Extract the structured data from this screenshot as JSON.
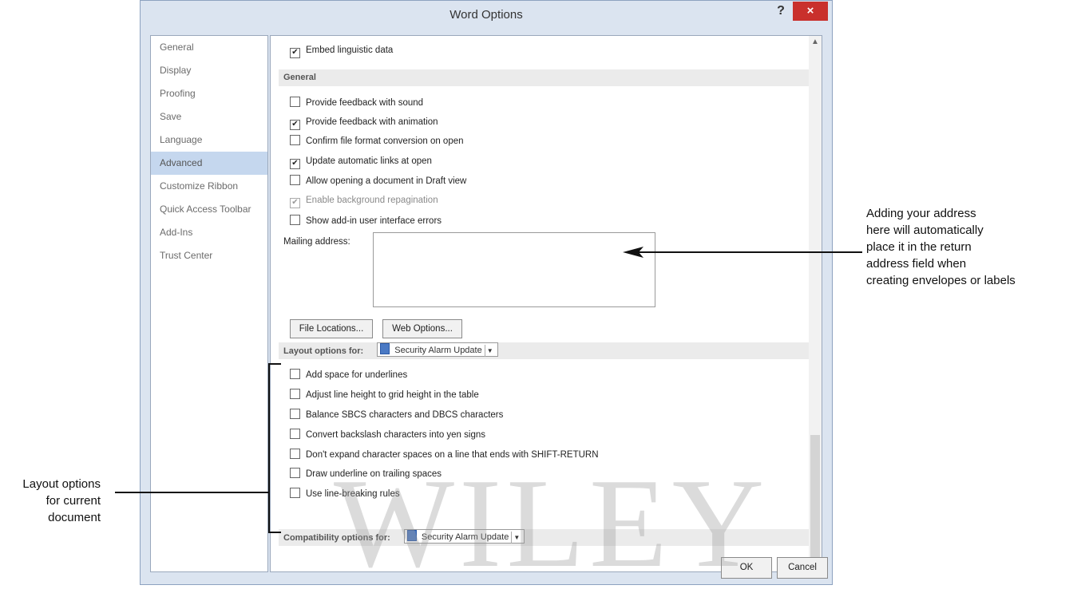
{
  "window": {
    "title": "Word Options",
    "help": "?",
    "close": "×"
  },
  "nav": {
    "items": [
      {
        "label": "General"
      },
      {
        "label": "Display"
      },
      {
        "label": "Proofing"
      },
      {
        "label": "Save"
      },
      {
        "label": "Language"
      },
      {
        "label": "Advanced",
        "active": true
      },
      {
        "label": "Customize Ribbon"
      },
      {
        "label": "Quick Access Toolbar"
      },
      {
        "label": "Add-Ins"
      },
      {
        "label": "Trust Center"
      }
    ]
  },
  "content": {
    "embed_linguistic": {
      "label": "Embed linguistic data",
      "checked": true
    },
    "general_section": "General",
    "general_options": [
      {
        "label": "Provide feedback with sound",
        "checked": false
      },
      {
        "label": "Provide feedback with animation",
        "checked": true
      },
      {
        "label": "Confirm file format conversion on open",
        "checked": false
      },
      {
        "label": "Update automatic links at open",
        "checked": true
      },
      {
        "label": "Allow opening a document in Draft view",
        "checked": false
      },
      {
        "label": "Enable background repagination",
        "checked": true,
        "disabled": true
      },
      {
        "label": "Show add-in user interface errors",
        "checked": false
      }
    ],
    "mailing_address_label": "Mailing address:",
    "mailing_address_value": "",
    "file_locations_button": "File Locations...",
    "web_options_button": "Web Options...",
    "layout_section": "Layout options for:",
    "layout_document": "Security Alarm Update",
    "layout_options": [
      {
        "label": "Add space for underlines",
        "checked": false
      },
      {
        "label": "Adjust line height to grid height in the table",
        "checked": false
      },
      {
        "label": "Balance SBCS characters and DBCS characters",
        "checked": false
      },
      {
        "label": "Convert backslash characters into yen signs",
        "checked": false
      },
      {
        "label": "Don't expand character spaces on a line that ends with SHIFT-RETURN",
        "checked": false
      },
      {
        "label": "Draw underline on trailing spaces",
        "checked": false
      },
      {
        "label": "Use line-breaking rules",
        "checked": false
      }
    ],
    "compat_section": "Compatibility options for:",
    "compat_document": "Security Alarm Update"
  },
  "footer": {
    "ok": "OK",
    "cancel": "Cancel"
  },
  "watermark": "WILEY",
  "annotations": {
    "right": [
      "Adding your address",
      "here will automatically",
      "place it in the return",
      "address field when",
      "creating envelopes or labels"
    ],
    "left": [
      "Layout options",
      "for current",
      "document"
    ]
  }
}
